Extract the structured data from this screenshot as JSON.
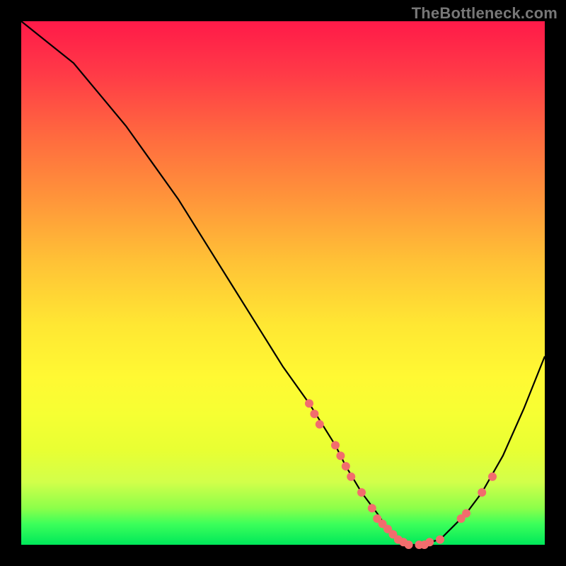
{
  "watermark": "TheBottleneck.com",
  "chart_data": {
    "type": "line",
    "title": "",
    "xlabel": "",
    "ylabel": "",
    "xlim": [
      0,
      100
    ],
    "ylim": [
      0,
      100
    ],
    "grid": false,
    "legend": false,
    "background": "heat-gradient",
    "series": [
      {
        "name": "bottleneck-curve",
        "x": [
          0,
          5,
          10,
          15,
          20,
          25,
          30,
          35,
          40,
          45,
          50,
          55,
          60,
          62,
          65,
          68,
          70,
          72,
          74,
          76,
          80,
          82,
          85,
          88,
          92,
          96,
          100
        ],
        "y": [
          100,
          96,
          92,
          86,
          80,
          73,
          66,
          58,
          50,
          42,
          34,
          27,
          19,
          15,
          10,
          6,
          3,
          1,
          0,
          0,
          1,
          3,
          6,
          10,
          17,
          26,
          36
        ]
      }
    ],
    "markers": [
      {
        "x": 55,
        "y": 27
      },
      {
        "x": 56,
        "y": 25
      },
      {
        "x": 57,
        "y": 23
      },
      {
        "x": 60,
        "y": 19
      },
      {
        "x": 61,
        "y": 17
      },
      {
        "x": 62,
        "y": 15
      },
      {
        "x": 63,
        "y": 13
      },
      {
        "x": 65,
        "y": 10
      },
      {
        "x": 67,
        "y": 7
      },
      {
        "x": 68,
        "y": 5
      },
      {
        "x": 69,
        "y": 4
      },
      {
        "x": 70,
        "y": 3
      },
      {
        "x": 71,
        "y": 2
      },
      {
        "x": 72,
        "y": 1
      },
      {
        "x": 73,
        "y": 0.5
      },
      {
        "x": 74,
        "y": 0
      },
      {
        "x": 76,
        "y": 0
      },
      {
        "x": 77,
        "y": 0
      },
      {
        "x": 78,
        "y": 0.5
      },
      {
        "x": 80,
        "y": 1
      },
      {
        "x": 84,
        "y": 5
      },
      {
        "x": 85,
        "y": 6
      },
      {
        "x": 88,
        "y": 10
      },
      {
        "x": 90,
        "y": 13
      }
    ],
    "marker_color": "#f26d6d",
    "marker_radius": 6
  }
}
